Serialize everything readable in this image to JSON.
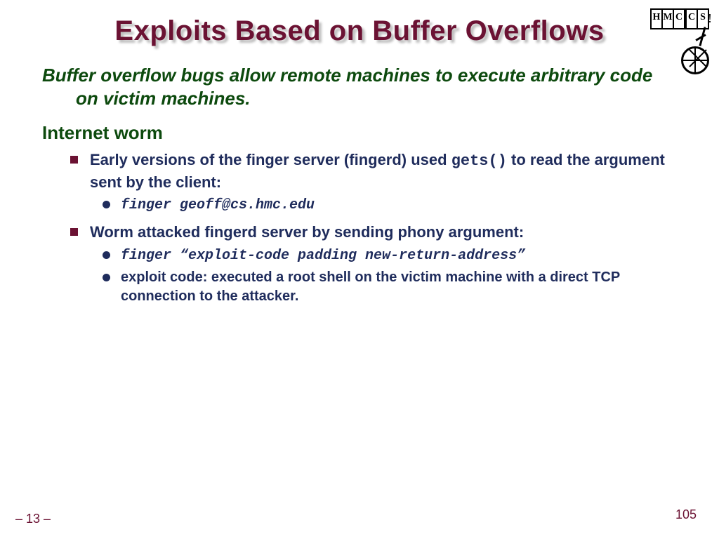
{
  "title": "Exploits Based on Buffer Overflows",
  "intro": "Buffer overflow bugs allow remote machines to execute arbitrary code on victim machines.",
  "section": "Internet worm",
  "bullet1_pre": "Early versions of the finger server (fingerd) used ",
  "bullet1_code": "gets()",
  "bullet1_post": " to read the argument sent by the client:",
  "sub1a": "finger geoff@cs.hmc.edu",
  "bullet2": "Worm attacked fingerd server by sending phony argument:",
  "sub2a": "finger “exploit-code  padding  new-return-address”",
  "sub2b": "exploit code: executed a root shell on the victim machine with a direct TCP connection to the attacker.",
  "page_left": "– 13 –",
  "page_right": "105",
  "logo": {
    "c1": "H",
    "c2": "M",
    "c3": "C",
    "c4": "C",
    "c5": "S",
    "excl": "!"
  }
}
